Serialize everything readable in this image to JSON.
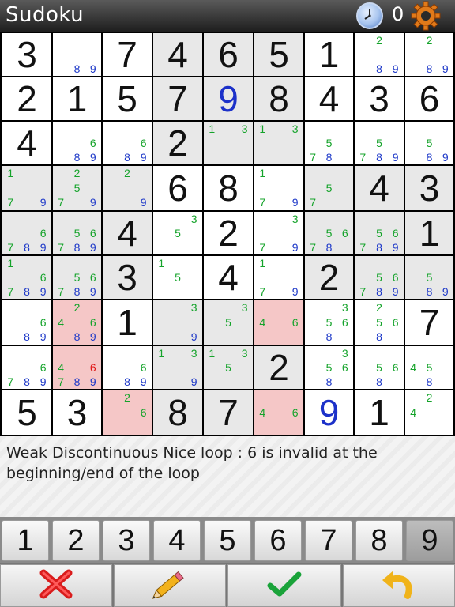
{
  "app": {
    "title": "Sudoku",
    "timer": "0"
  },
  "hint": {
    "text": "Weak Discontinuous Nice loop : 6 is invalid at the beginning/end of the loop"
  },
  "board": {
    "cells": [
      [
        {
          "v": "3"
        },
        {
          "c": [
            "8",
            "9"
          ]
        },
        {
          "v": "7"
        },
        {
          "v": "4"
        },
        {
          "v": "6"
        },
        {
          "v": "5"
        },
        {
          "v": "1"
        },
        {
          "c": [
            "2",
            "8",
            "9"
          ]
        },
        {
          "c": [
            "2",
            "8",
            "9"
          ]
        }
      ],
      [
        {
          "v": "2"
        },
        {
          "v": "1"
        },
        {
          "v": "5"
        },
        {
          "v": "7"
        },
        {
          "v": "9",
          "blue": true
        },
        {
          "v": "8"
        },
        {
          "v": "4"
        },
        {
          "v": "3"
        },
        {
          "v": "6"
        }
      ],
      [
        {
          "v": "4"
        },
        {
          "c": [
            "6",
            "8",
            "9"
          ]
        },
        {
          "c": [
            "6",
            "8",
            "9"
          ]
        },
        {
          "v": "2"
        },
        {
          "c": [
            "1",
            "3"
          ]
        },
        {
          "c": [
            "1",
            "3"
          ]
        },
        {
          "c": [
            "5",
            "7",
            "8"
          ]
        },
        {
          "c": [
            "5",
            "7",
            "8",
            "9"
          ]
        },
        {
          "c": [
            "5",
            "8",
            "9"
          ]
        }
      ],
      [
        {
          "c": [
            "1",
            "7",
            "9"
          ]
        },
        {
          "c": [
            "2",
            "5",
            "7",
            "9"
          ]
        },
        {
          "c": [
            "2",
            "9"
          ]
        },
        {
          "v": "6"
        },
        {
          "v": "8"
        },
        {
          "c": [
            "1",
            "7",
            "9"
          ]
        },
        {
          "c": [
            "5",
            "7"
          ]
        },
        {
          "v": "4"
        },
        {
          "v": "3"
        }
      ],
      [
        {
          "c": [
            "6",
            "7",
            "8",
            "9"
          ]
        },
        {
          "c": [
            "5",
            "6",
            "7",
            "8",
            "9"
          ]
        },
        {
          "v": "4"
        },
        {
          "c": [
            "3",
            "5"
          ]
        },
        {
          "v": "2"
        },
        {
          "c": [
            "3",
            "7",
            "9"
          ]
        },
        {
          "c": [
            "5",
            "6",
            "7",
            "8"
          ]
        },
        {
          "c": [
            "5",
            "6",
            "7",
            "8",
            "9"
          ]
        },
        {
          "v": "1"
        }
      ],
      [
        {
          "c": [
            "1",
            "6",
            "7",
            "8",
            "9"
          ]
        },
        {
          "c": [
            "5",
            "6",
            "7",
            "8",
            "9"
          ]
        },
        {
          "v": "3"
        },
        {
          "c": [
            "1",
            "5"
          ]
        },
        {
          "v": "4"
        },
        {
          "c": [
            "1",
            "7",
            "9"
          ]
        },
        {
          "v": "2"
        },
        {
          "c": [
            "5",
            "6",
            "7",
            "8",
            "9"
          ]
        },
        {
          "c": [
            "5",
            "8",
            "9"
          ]
        }
      ],
      [
        {
          "c": [
            "6",
            "8",
            "9"
          ]
        },
        {
          "c": [
            "2",
            "4",
            "6",
            "8",
            "9"
          ],
          "red": true
        },
        {
          "v": "1"
        },
        {
          "c": [
            "3",
            "9"
          ]
        },
        {
          "c": [
            "3",
            "5"
          ]
        },
        {
          "c": [
            "4",
            "6"
          ],
          "red": true
        },
        {
          "c": [
            "3",
            "5",
            "6",
            "8"
          ]
        },
        {
          "c": [
            "2",
            "5",
            "6",
            "8"
          ]
        },
        {
          "v": "7"
        }
      ],
      [
        {
          "c": [
            "6",
            "7",
            "8",
            "9"
          ]
        },
        {
          "c": [
            "4",
            "6",
            "7",
            "8",
            "9"
          ],
          "red": true,
          "redDigit": "6"
        },
        {
          "c": [
            "6",
            "8",
            "9"
          ]
        },
        {
          "c": [
            "1",
            "3",
            "9"
          ]
        },
        {
          "c": [
            "1",
            "3",
            "5"
          ]
        },
        {
          "v": "2"
        },
        {
          "c": [
            "3",
            "5",
            "6",
            "8"
          ]
        },
        {
          "c": [
            "5",
            "6",
            "8"
          ]
        },
        {
          "c": [
            "4",
            "5",
            "8"
          ]
        }
      ],
      [
        {
          "v": "5"
        },
        {
          "v": "3"
        },
        {
          "c": [
            "2",
            "6"
          ],
          "red": true
        },
        {
          "v": "8"
        },
        {
          "v": "7"
        },
        {
          "c": [
            "4",
            "6"
          ],
          "red": true
        },
        {
          "v": "9",
          "blue": true
        },
        {
          "v": "1"
        },
        {
          "c": [
            "2",
            "4"
          ]
        }
      ]
    ]
  },
  "numpad": {
    "keys": [
      "1",
      "2",
      "3",
      "4",
      "5",
      "6",
      "7",
      "8",
      "9"
    ],
    "selected": "9"
  },
  "actions": [
    {
      "name": "delete-button",
      "icon": "red-x-icon"
    },
    {
      "name": "pencil-button",
      "icon": "pencil-icon"
    },
    {
      "name": "confirm-button",
      "icon": "checkmark-icon"
    },
    {
      "name": "undo-button",
      "icon": "undo-arrow-icon"
    }
  ],
  "colors": {
    "given": "#111111",
    "entered": "#1c31c9",
    "candidate": "#14a32a",
    "candidate_blue": "#1d38c8",
    "highlight": "#f5c7c7",
    "shade": "#e8e8e8"
  }
}
